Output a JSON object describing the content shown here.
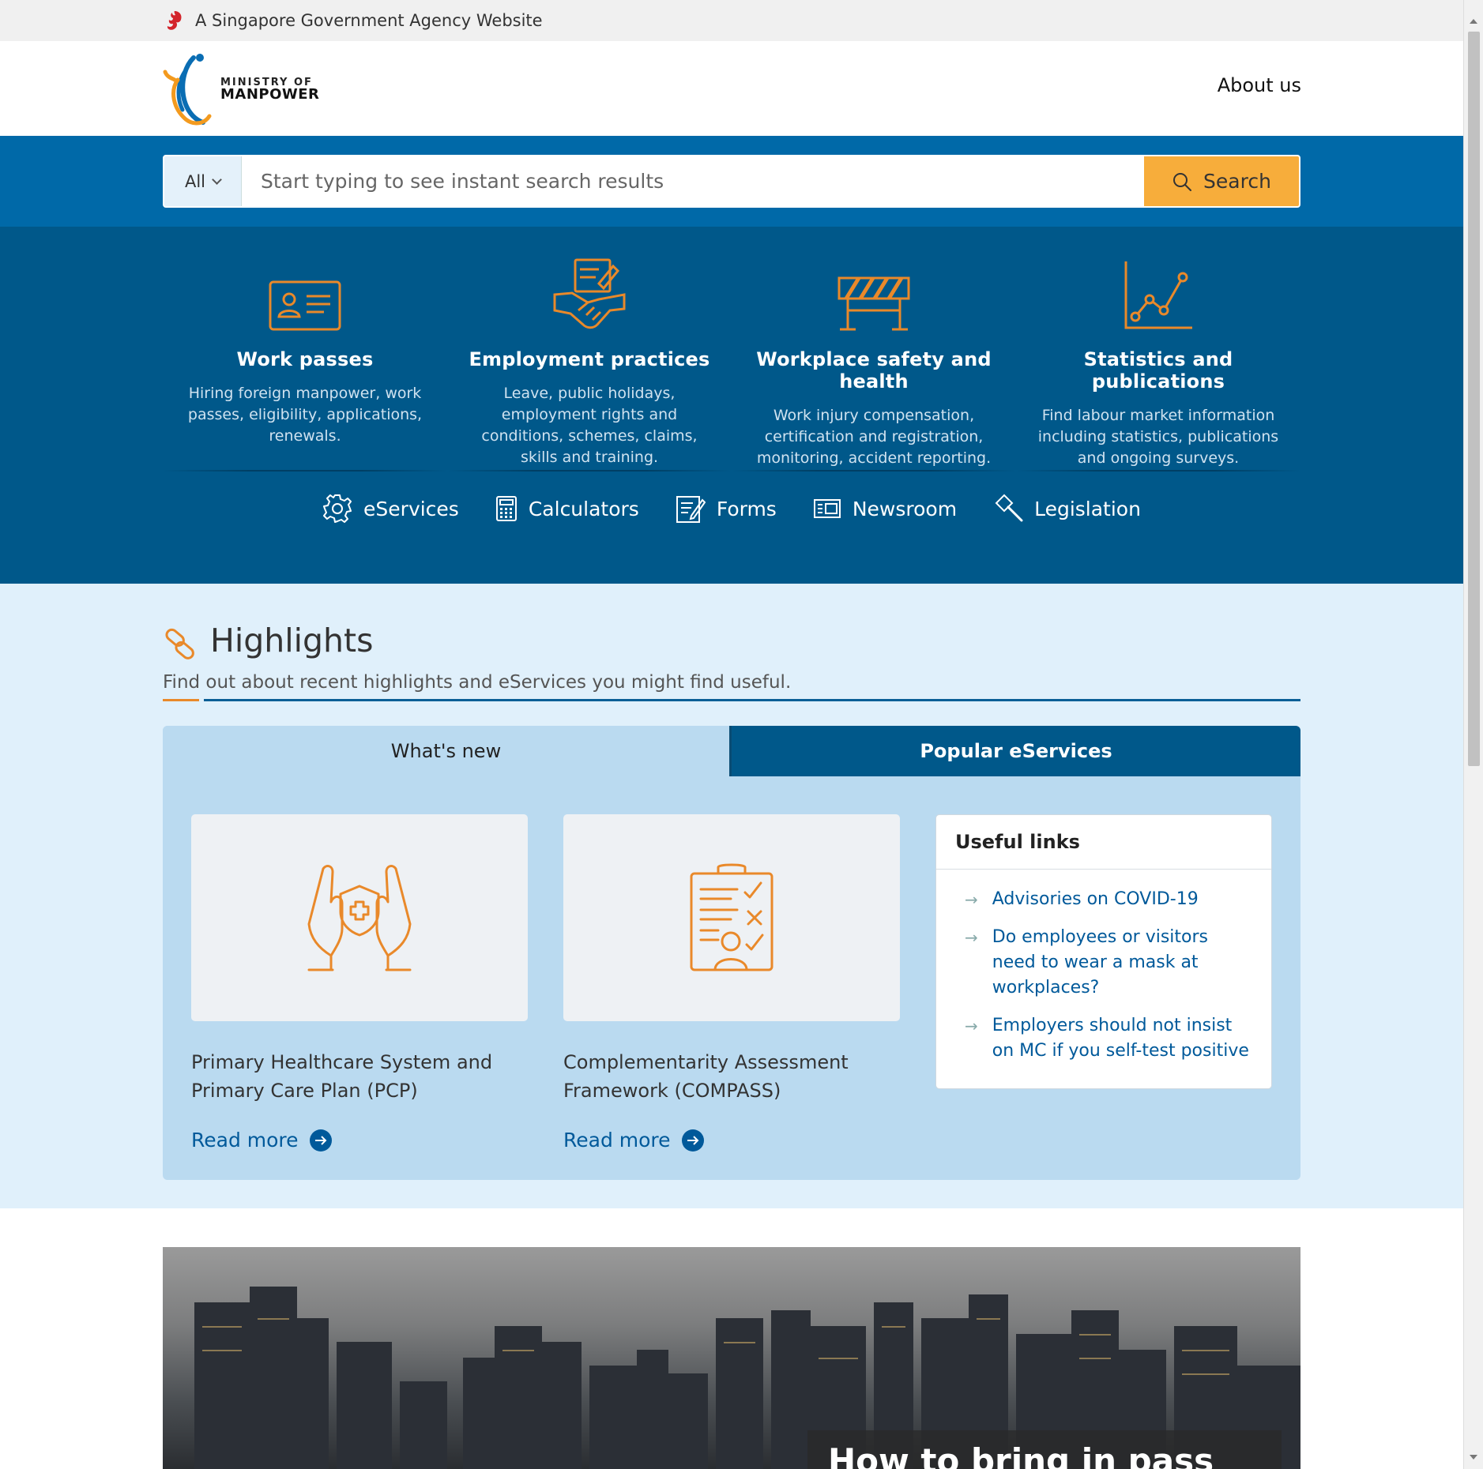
{
  "gov_banner": {
    "text": "A Singapore Government Agency Website"
  },
  "header": {
    "logo_line1": "MINISTRY OF",
    "logo_line2": "MANPOWER",
    "about_label": "About us"
  },
  "search": {
    "scope_value": "All",
    "placeholder": "Start typing to see instant search results",
    "button_label": "Search"
  },
  "categories": [
    {
      "title": "Work passes",
      "desc": "Hiring foreign manpower, work passes, eligibility, applications, renewals.",
      "icon": "id-card-icon"
    },
    {
      "title": "Employment practices",
      "desc": "Leave, public holidays, employment rights and conditions, schemes, claims, skills and training.",
      "icon": "handshake-icon"
    },
    {
      "title": "Workplace safety and health",
      "desc": "Work injury compensation, certification and registration, monitoring, accident reporting.",
      "icon": "barrier-icon"
    },
    {
      "title": "Statistics and publications",
      "desc": "Find labour market information including statistics, publications and ongoing surveys.",
      "icon": "line-chart-icon"
    }
  ],
  "quick_links": [
    {
      "label": "eServices",
      "icon": "gear-icon"
    },
    {
      "label": "Calculators",
      "icon": "calculator-icon"
    },
    {
      "label": "Forms",
      "icon": "form-icon"
    },
    {
      "label": "Newsroom",
      "icon": "newspaper-icon"
    },
    {
      "label": "Legislation",
      "icon": "gavel-icon"
    }
  ],
  "highlights": {
    "title": "Highlights",
    "subtitle": "Find out about recent highlights and eServices you might find useful.",
    "tabs": [
      {
        "label": "What's new",
        "active": true
      },
      {
        "label": "Popular eServices",
        "active": false
      }
    ],
    "cards": [
      {
        "title": "Primary Healthcare System and Primary Care Plan (PCP)",
        "more": "Read more",
        "icon": "hands-shield-icon"
      },
      {
        "title": "Complementarity Assessment Framework (COMPASS)",
        "more": "Read more",
        "icon": "clipboard-checklist-icon"
      }
    ],
    "useful_links": {
      "title": "Useful links",
      "items": [
        "Advisories on COVID-19",
        "Do employees or visitors need to wear a mask at workplaces?",
        "Employers should not insist on MC if you self-test positive"
      ]
    }
  },
  "hero": {
    "caption": "How to bring in pass"
  },
  "colors": {
    "search_band": "#0069a8",
    "category_band": "#00588a",
    "accent_orange": "#f7ad3b",
    "icon_orange": "#e9892a",
    "highlights_bg": "#e0f0fb",
    "panel_bg": "#badaf0",
    "link_blue": "#00599a"
  }
}
